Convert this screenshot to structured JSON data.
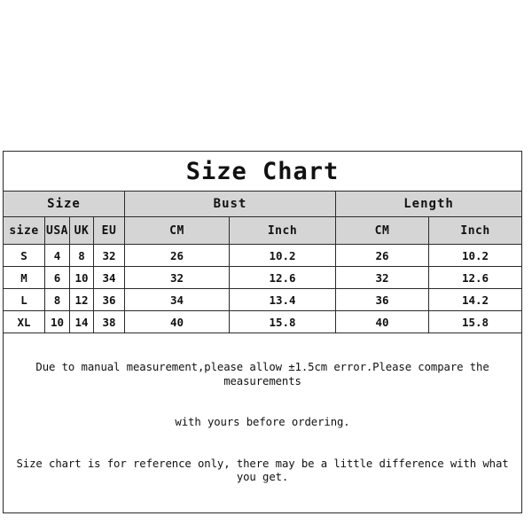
{
  "title": "Size Chart",
  "group_headers": [
    {
      "label": "Size",
      "span": 4
    },
    {
      "label": "Bust",
      "span": 2
    },
    {
      "label": "Length",
      "span": 2
    }
  ],
  "column_headers": [
    "size",
    "USA",
    "UK",
    "EU",
    "CM",
    "Inch",
    "CM",
    "Inch"
  ],
  "rows": [
    {
      "size": "S",
      "usa": "4",
      "uk": "8",
      "eu": "32",
      "bust_cm": "26",
      "bust_inch": "10.2",
      "length_cm": "26",
      "length_inch": "10.2"
    },
    {
      "size": "M",
      "usa": "6",
      "uk": "10",
      "eu": "34",
      "bust_cm": "32",
      "bust_inch": "12.6",
      "length_cm": "32",
      "length_inch": "12.6"
    },
    {
      "size": "L",
      "usa": "8",
      "uk": "12",
      "eu": "36",
      "bust_cm": "34",
      "bust_inch": "13.4",
      "length_cm": "36",
      "length_inch": "14.2"
    },
    {
      "size": "XL",
      "usa": "10",
      "uk": "14",
      "eu": "38",
      "bust_cm": "40",
      "bust_inch": "15.8",
      "length_cm": "40",
      "length_inch": "15.8"
    }
  ],
  "notes": [
    "Due to manual measurement,please allow ±1.5cm error.Please compare the measurements",
    "with yours before ordering.",
    "Size chart is for reference only, there may be a little difference with what you get."
  ],
  "colors": {
    "header_bg": "#d5d5d5",
    "cell_bg": "#ffffff",
    "border": "#2b2b2b",
    "text": "#111111",
    "page_bg": "#ffffff"
  }
}
